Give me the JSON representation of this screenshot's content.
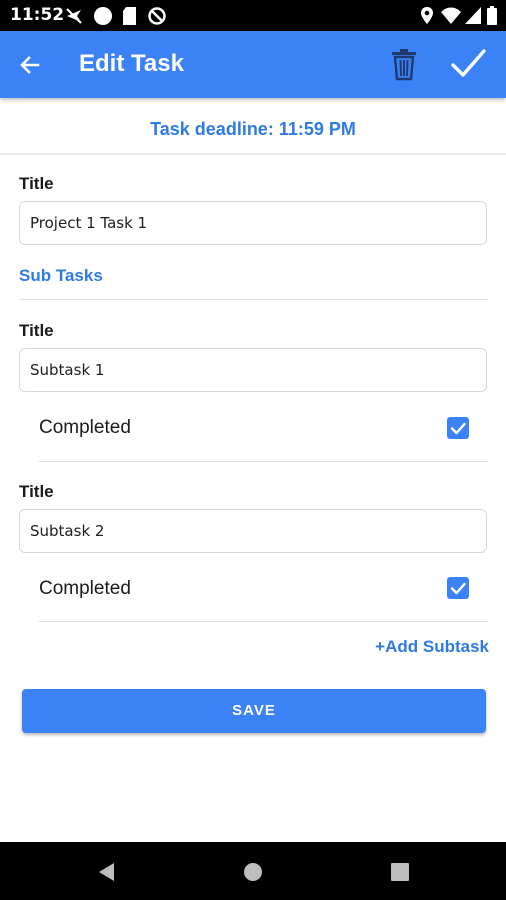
{
  "status_bar": {
    "time": "11:52",
    "left_icons": [
      "airplane-silent-icon",
      "circle-dot-icon",
      "sd-card-icon",
      "no-signal-icon"
    ],
    "right_icons": [
      "location-icon",
      "wifi-icon",
      "signal-icon",
      "battery-icon"
    ]
  },
  "app_bar": {
    "title": "Edit Task",
    "color": "#3b82f6",
    "back_icon": "arrow-left-icon",
    "delete_icon": "trash-icon",
    "confirm_icon": "check-icon"
  },
  "deadline": {
    "text": "Task deadline: 11:59 PM"
  },
  "task": {
    "title_label": "Title",
    "title_value": "Project 1 Task 1"
  },
  "subtasks_header": "Sub Tasks",
  "subtasks": [
    {
      "title_label": "Title",
      "title_value": "Subtask 1",
      "completed_label": "Completed",
      "completed": true
    },
    {
      "title_label": "Title",
      "title_value": "Subtask 2",
      "completed_label": "Completed",
      "completed": true
    }
  ],
  "add_subtask_label": "+Add Subtask",
  "save_label": "SAVE",
  "nav_bar": {
    "icons": [
      "back-triangle-icon",
      "home-circle-icon",
      "recents-square-icon"
    ]
  }
}
